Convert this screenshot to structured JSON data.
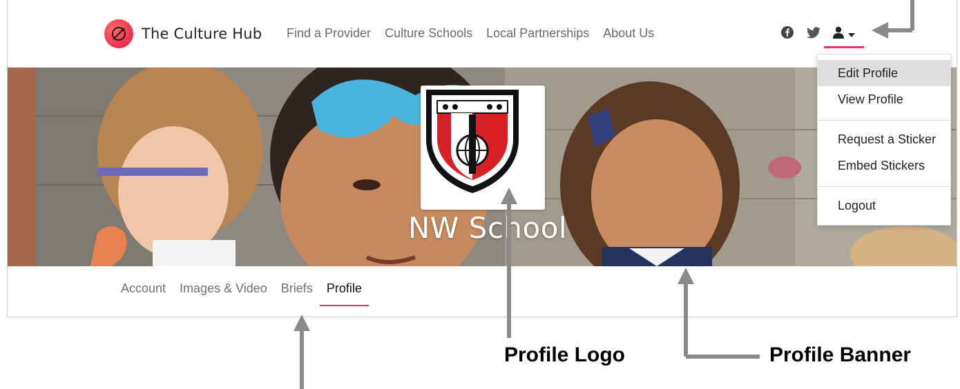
{
  "brand": {
    "name": "The Culture Hub",
    "logo_icon": "compass-icon"
  },
  "nav": {
    "links": [
      "Find a Provider",
      "Culture Schools",
      "Local Partnerships",
      "About Us"
    ],
    "social_icons": [
      "facebook-icon",
      "twitter-icon"
    ],
    "user_icon": "user-icon",
    "caret_icon": "caret-down-icon"
  },
  "banner": {
    "school_name": "NW School"
  },
  "dropdown": {
    "items": [
      "Edit Profile",
      "View Profile",
      "Request a Sticker",
      "Embed Stickers",
      "Logout"
    ],
    "active_item": "Edit Profile"
  },
  "tabs": {
    "items": [
      "Account",
      "Images & Video",
      "Briefs",
      "Profile"
    ],
    "active": "Profile"
  },
  "annotations": {
    "logo_label": "Profile Logo",
    "banner_label": "Profile Banner"
  },
  "colors": {
    "accent": "#e8316b",
    "brand_red": "#ea2e4f",
    "arrow_gray": "#8a8a8a"
  }
}
